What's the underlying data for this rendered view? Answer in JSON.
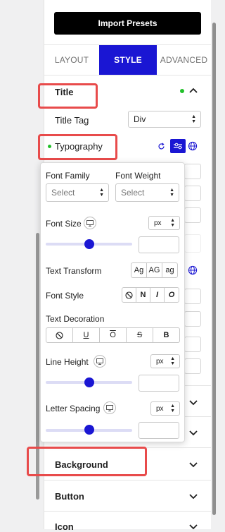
{
  "import_presets_label": "Import Presets",
  "tabs": [
    {
      "label": "LAYOUT",
      "active": false
    },
    {
      "label": "STYLE",
      "active": true
    },
    {
      "label": "ADVANCED",
      "active": false
    }
  ],
  "title_section": {
    "label": "Title",
    "title_tag_label": "Title Tag",
    "title_tag_value": "Div",
    "typography_label": "Typography"
  },
  "typography_popup": {
    "font_family_label": "Font Family",
    "font_family_value": "Select",
    "font_weight_label": "Font Weight",
    "font_weight_value": "Select",
    "font_size_label": "Font Size",
    "font_size_unit": "px",
    "font_size_slider_level": 0.5,
    "text_transform_label": "Text Transform",
    "text_transform_options": [
      "Ag",
      "AG",
      "ag"
    ],
    "font_style_label": "Font Style",
    "font_style_options": [
      "⃠",
      "N",
      "I",
      "O"
    ],
    "text_decoration_label": "Text Decoration",
    "text_decoration_options": [
      "⃠",
      "U",
      "O",
      "S",
      "B"
    ],
    "line_height_label": "Line Height",
    "line_height_unit": "px",
    "line_height_slider_level": 0.5,
    "letter_spacing_label": "Letter Spacing",
    "letter_spacing_unit": "px",
    "letter_spacing_slider_level": 0.5
  },
  "sections": [
    "Background",
    "Button",
    "Icon"
  ],
  "colors": {
    "accent": "#1a16d3",
    "highlight": "#e84b4b",
    "active_dot": "#22c02a"
  },
  "icons": [
    "chevron-up-icon",
    "chevron-down-icon",
    "reset-icon",
    "sliders-icon",
    "globe-icon",
    "monitor-icon",
    "none-icon"
  ]
}
